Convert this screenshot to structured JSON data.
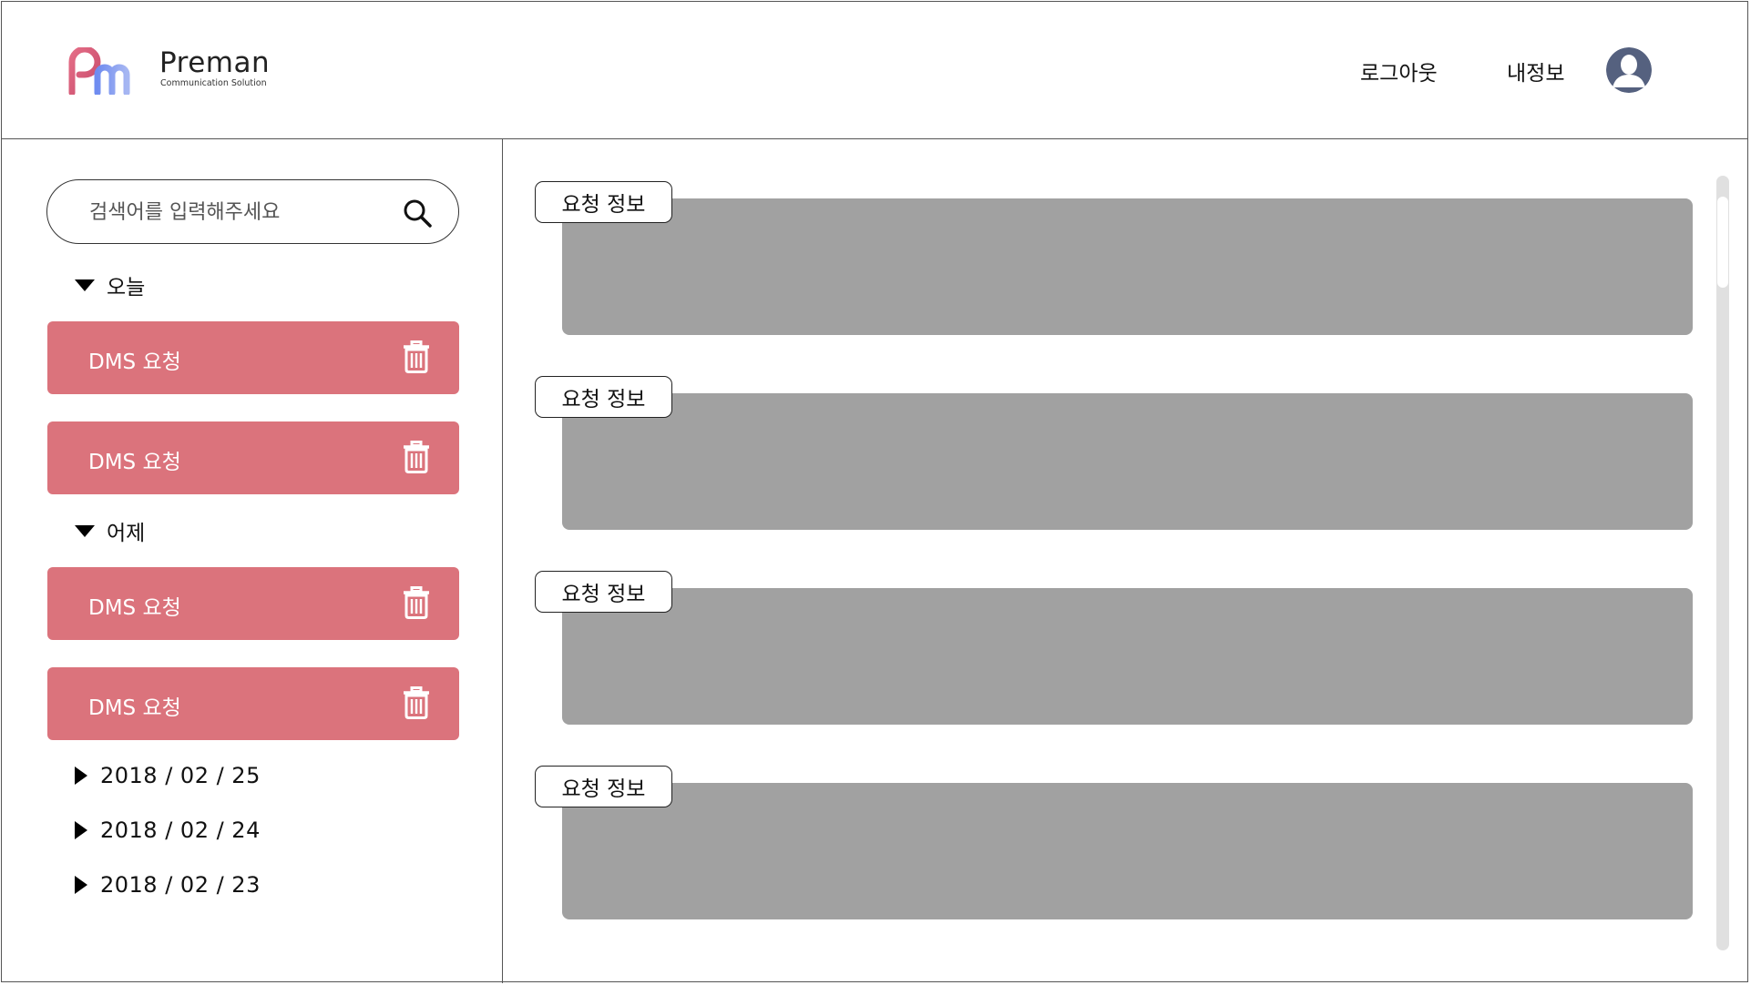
{
  "app": {
    "brand_name": "Preman",
    "brand_tagline": "Communication Solution"
  },
  "header": {
    "logout_label": "로그아웃",
    "profile_label": "내정보"
  },
  "sidebar": {
    "search_placeholder": "검색어를 입력해주세요",
    "groups": [
      {
        "label": "오늘",
        "items": [
          {
            "label": "DMS 요청"
          },
          {
            "label": "DMS 요청"
          }
        ]
      },
      {
        "label": "어제",
        "items": [
          {
            "label": "DMS 요청"
          },
          {
            "label": "DMS 요청"
          }
        ]
      }
    ],
    "dates": [
      "2018 / 02 / 25",
      "2018 / 02 / 24",
      "2018 / 02 / 23"
    ]
  },
  "main": {
    "cards": [
      {
        "tag": "요청 정보"
      },
      {
        "tag": "요청 정보"
      },
      {
        "tag": "요청 정보"
      },
      {
        "tag": "요청 정보"
      }
    ]
  },
  "colors": {
    "request_item": "#db737c",
    "card_body": "#a1a1a1",
    "logo_pink": "#e46d86",
    "logo_blue": "#7e97ec",
    "avatar": "#55617f"
  },
  "icons": {
    "search": "search-icon",
    "trash": "trash-icon",
    "expanded": "triangle-down-icon",
    "collapsed": "triangle-right-icon",
    "avatar": "user-avatar-icon"
  }
}
